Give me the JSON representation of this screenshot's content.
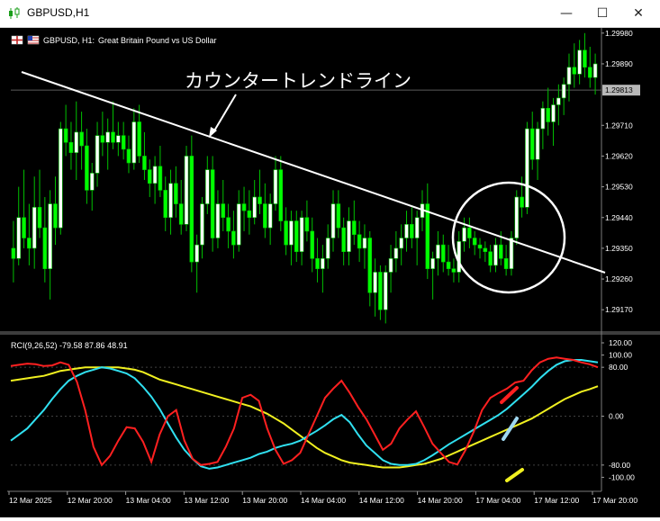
{
  "window": {
    "title": "GBPUSD,H1",
    "icons": {
      "app": "candle-chart-icon",
      "minimize": "minimize-icon",
      "maximize": "maximize-icon",
      "close": "close-icon"
    },
    "controls": {
      "minimize": "—",
      "maximize": "☐",
      "close": "✕"
    }
  },
  "chart": {
    "header_symbol": "GBPUSD, H1:",
    "header_desc": "Great Britain Pound vs US Dollar",
    "price_axis_labels": [
      "1.29980",
      "1.29890",
      "1.29710",
      "1.29620",
      "1.29530",
      "1.29440",
      "1.29350",
      "1.29260",
      "1.29170"
    ],
    "current_price_label": "1.29813",
    "annotation": "カウンタートレンドライン",
    "colors": {
      "background": "#000000",
      "bull": "#ffffff",
      "bear": "#00ff00",
      "wick": "#00c000",
      "trendline": "#ffffff",
      "circle": "#ffffff"
    }
  },
  "indicator": {
    "label": "RCI(9,26,52) -79.58 87.86 48.91",
    "axis_labels": [
      "120.00",
      "100.00",
      "80.00",
      "0.00",
      "-80.00",
      "-100.00"
    ],
    "colors": {
      "fast": "#ff2020",
      "mid": "#30e0f0",
      "slow": "#f0f020"
    }
  },
  "time_axis_labels": [
    "12 Mar 2025",
    "12 Mar 20:00",
    "13 Mar 04:00",
    "13 Mar 12:00",
    "13 Mar 20:00",
    "14 Mar 04:00",
    "14 Mar 12:00",
    "14 Mar 20:00",
    "17 Mar 04:00",
    "17 Mar 12:00",
    "17 Mar 20:00"
  ],
  "chart_data": {
    "type": "candlestick",
    "price_ylim": [
      1.2911,
      1.2999
    ],
    "candles": [
      [
        1.2935,
        1.2943,
        1.2925,
        1.2932
      ],
      [
        1.2932,
        1.2953,
        1.293,
        1.2944
      ],
      [
        1.2944,
        1.2958,
        1.2935,
        1.2938
      ],
      [
        1.2938,
        1.2948,
        1.293,
        1.2935
      ],
      [
        1.2935,
        1.2956,
        1.2929,
        1.2947
      ],
      [
        1.2947,
        1.2958,
        1.2938,
        1.2941
      ],
      [
        1.2941,
        1.295,
        1.2925,
        1.2929
      ],
      [
        1.2929,
        1.2952,
        1.292,
        1.2948
      ],
      [
        1.2948,
        1.2956,
        1.2936,
        1.2941
      ],
      [
        1.2941,
        1.2972,
        1.2939,
        1.297
      ],
      [
        1.297,
        1.2977,
        1.2962,
        1.2966
      ],
      [
        1.2966,
        1.2972,
        1.2958,
        1.2963
      ],
      [
        1.2963,
        1.2978,
        1.2955,
        1.2969
      ],
      [
        1.2969,
        1.2975,
        1.2958,
        1.2965
      ],
      [
        1.2965,
        1.297,
        1.2948,
        1.2952
      ],
      [
        1.2952,
        1.296,
        1.2946,
        1.2957
      ],
      [
        1.2957,
        1.2972,
        1.2953,
        1.2968
      ],
      [
        1.2968,
        1.2975,
        1.2962,
        1.2966
      ],
      [
        1.2966,
        1.2973,
        1.2958,
        1.2969
      ],
      [
        1.2969,
        1.2978,
        1.2964,
        1.2966
      ],
      [
        1.2966,
        1.2972,
        1.2962,
        1.2968
      ],
      [
        1.2968,
        1.2972,
        1.2961,
        1.2964
      ],
      [
        1.2964,
        1.2968,
        1.2957,
        1.296
      ],
      [
        1.296,
        1.2976,
        1.2958,
        1.2972
      ],
      [
        1.2972,
        1.2977,
        1.296,
        1.2962
      ],
      [
        1.2962,
        1.2969,
        1.2955,
        1.2958
      ],
      [
        1.2958,
        1.2961,
        1.295,
        1.2954
      ],
      [
        1.2954,
        1.2962,
        1.2948,
        1.2959
      ],
      [
        1.2959,
        1.2965,
        1.295,
        1.2952
      ],
      [
        1.2952,
        1.2956,
        1.294,
        1.2944
      ],
      [
        1.2944,
        1.2958,
        1.2939,
        1.2954
      ],
      [
        1.2954,
        1.2959,
        1.2944,
        1.2948
      ],
      [
        1.2948,
        1.2955,
        1.2939,
        1.2942
      ],
      [
        1.2942,
        1.2965,
        1.294,
        1.2962
      ],
      [
        1.2962,
        1.2968,
        1.2928,
        1.2931
      ],
      [
        1.2931,
        1.2939,
        1.2922,
        1.2936
      ],
      [
        1.2936,
        1.295,
        1.2932,
        1.2948
      ],
      [
        1.2948,
        1.2962,
        1.2945,
        1.2958
      ],
      [
        1.2958,
        1.2962,
        1.2934,
        1.2938
      ],
      [
        1.2938,
        1.2952,
        1.2935,
        1.2948
      ],
      [
        1.2948,
        1.2955,
        1.294,
        1.2944
      ],
      [
        1.2944,
        1.2948,
        1.2935,
        1.294
      ],
      [
        1.294,
        1.2946,
        1.2932,
        1.2936
      ],
      [
        1.2936,
        1.2952,
        1.2934,
        1.2948
      ],
      [
        1.2948,
        1.2953,
        1.294,
        1.2946
      ],
      [
        1.2946,
        1.2952,
        1.2939,
        1.2944
      ],
      [
        1.2944,
        1.2955,
        1.2942,
        1.295
      ],
      [
        1.295,
        1.2958,
        1.2945,
        1.2948
      ],
      [
        1.2948,
        1.2954,
        1.2938,
        1.2941
      ],
      [
        1.2941,
        1.2951,
        1.2936,
        1.2948
      ],
      [
        1.2948,
        1.2962,
        1.2946,
        1.2958
      ],
      [
        1.2958,
        1.2962,
        1.294,
        1.2943
      ],
      [
        1.2943,
        1.2947,
        1.2933,
        1.2936
      ],
      [
        1.2936,
        1.2946,
        1.293,
        1.2943
      ],
      [
        1.2943,
        1.2946,
        1.2931,
        1.2934
      ],
      [
        1.2934,
        1.2946,
        1.293,
        1.2944
      ],
      [
        1.2944,
        1.2949,
        1.2937,
        1.294
      ],
      [
        1.294,
        1.2944,
        1.2928,
        1.2932
      ],
      [
        1.2932,
        1.2938,
        1.2925,
        1.2929
      ],
      [
        1.2929,
        1.2936,
        1.2922,
        1.2932
      ],
      [
        1.2932,
        1.2942,
        1.2929,
        1.2938
      ],
      [
        1.2938,
        1.2952,
        1.2934,
        1.2948
      ],
      [
        1.2948,
        1.2952,
        1.2938,
        1.2941
      ],
      [
        1.2941,
        1.2944,
        1.293,
        1.2934
      ],
      [
        1.2934,
        1.2947,
        1.293,
        1.2943
      ],
      [
        1.2943,
        1.2949,
        1.2936,
        1.2939
      ],
      [
        1.2939,
        1.2943,
        1.2931,
        1.2935
      ],
      [
        1.2935,
        1.2942,
        1.2929,
        1.2938
      ],
      [
        1.2938,
        1.294,
        1.2918,
        1.2922
      ],
      [
        1.2922,
        1.2932,
        1.2915,
        1.2928
      ],
      [
        1.2928,
        1.293,
        1.2914,
        1.2917
      ],
      [
        1.2917,
        1.293,
        1.2913,
        1.2928
      ],
      [
        1.2928,
        1.2936,
        1.2922,
        1.2932
      ],
      [
        1.2932,
        1.294,
        1.2928,
        1.2935
      ],
      [
        1.2935,
        1.2942,
        1.293,
        1.2938
      ],
      [
        1.2938,
        1.2946,
        1.2934,
        1.2942
      ],
      [
        1.2942,
        1.2947,
        1.2935,
        1.2938
      ],
      [
        1.2938,
        1.2946,
        1.293,
        1.2944
      ],
      [
        1.2944,
        1.2952,
        1.294,
        1.2948
      ],
      [
        1.2948,
        1.2954,
        1.2926,
        1.2929
      ],
      [
        1.2929,
        1.2934,
        1.292,
        1.2932
      ],
      [
        1.2932,
        1.294,
        1.2927,
        1.2936
      ],
      [
        1.2936,
        1.2939,
        1.2928,
        1.2931
      ],
      [
        1.2931,
        1.2936,
        1.2927,
        1.2929
      ],
      [
        1.2929,
        1.2932,
        1.2925,
        1.2928
      ],
      [
        1.2928,
        1.294,
        1.2925,
        1.2937
      ],
      [
        1.2937,
        1.2944,
        1.2934,
        1.2941
      ],
      [
        1.2941,
        1.2944,
        1.2935,
        1.2938
      ],
      [
        1.2938,
        1.294,
        1.2933,
        1.2936
      ],
      [
        1.2936,
        1.2938,
        1.2932,
        1.2935
      ],
      [
        1.2935,
        1.2937,
        1.2931,
        1.2934
      ],
      [
        1.2934,
        1.2936,
        1.2928,
        1.293
      ],
      [
        1.293,
        1.2938,
        1.2928,
        1.2936
      ],
      [
        1.2936,
        1.294,
        1.293,
        1.2932
      ],
      [
        1.2932,
        1.2936,
        1.2927,
        1.2929
      ],
      [
        1.2929,
        1.294,
        1.2927,
        1.2938
      ],
      [
        1.2938,
        1.2952,
        1.2936,
        1.295
      ],
      [
        1.295,
        1.2956,
        1.2944,
        1.2947
      ],
      [
        1.2947,
        1.2972,
        1.2945,
        1.297
      ],
      [
        1.297,
        1.2975,
        1.2958,
        1.2961
      ],
      [
        1.2961,
        1.2972,
        1.2955,
        1.297
      ],
      [
        1.297,
        1.2978,
        1.2964,
        1.2976
      ],
      [
        1.2976,
        1.2982,
        1.2968,
        1.2972
      ],
      [
        1.2972,
        1.2979,
        1.2965,
        1.2977
      ],
      [
        1.2977,
        1.2983,
        1.2971,
        1.2979
      ],
      [
        1.2979,
        1.2985,
        1.2974,
        1.2983
      ],
      [
        1.2983,
        1.2992,
        1.2978,
        1.2988
      ],
      [
        1.2988,
        1.2995,
        1.2982,
        1.2986
      ],
      [
        1.2986,
        1.2996,
        1.2983,
        1.2993
      ],
      [
        1.2993,
        1.2998,
        1.2985,
        1.2988
      ],
      [
        1.2988,
        1.2994,
        1.2982,
        1.2985
      ],
      [
        1.2985,
        1.2992,
        1.298,
        1.2989
      ]
    ],
    "indicator_ylim": [
      -120,
      120
    ],
    "rci_fast": [
      82,
      84,
      86,
      85,
      82,
      83,
      88,
      84,
      56,
      10,
      -50,
      -80,
      -65,
      -40,
      -18,
      -20,
      -42,
      -75,
      -30,
      0,
      10,
      -40,
      -70,
      -80,
      -78,
      -75,
      -50,
      -20,
      30,
      35,
      25,
      -20,
      -55,
      -78,
      -72,
      -60,
      -30,
      0,
      30,
      45,
      58,
      38,
      15,
      -5,
      -30,
      -55,
      -45,
      -20,
      -5,
      8,
      -18,
      -45,
      -60,
      -75,
      -79,
      -55,
      -25,
      10,
      30,
      38,
      45,
      55,
      58,
      75,
      88,
      94,
      96,
      94,
      92,
      88,
      85,
      80
    ],
    "rci_mid": [
      -40,
      -30,
      -20,
      -5,
      10,
      28,
      44,
      58,
      66,
      72,
      76,
      80,
      78,
      74,
      70,
      62,
      48,
      32,
      12,
      -12,
      -35,
      -55,
      -70,
      -82,
      -86,
      -84,
      -80,
      -76,
      -72,
      -68,
      -62,
      -58,
      -52,
      -48,
      -45,
      -40,
      -32,
      -24,
      -15,
      -5,
      2,
      -10,
      -30,
      -48,
      -60,
      -72,
      -78,
      -80,
      -80,
      -78,
      -72,
      -64,
      -55,
      -46,
      -38,
      -30,
      -22,
      -14,
      -6,
      2,
      12,
      24,
      36,
      48,
      62,
      74,
      84,
      90,
      92,
      92,
      90,
      88
    ],
    "rci_slow": [
      58,
      60,
      62,
      64,
      66,
      70,
      74,
      76,
      78,
      80,
      80,
      80,
      80,
      80,
      78,
      76,
      72,
      66,
      60,
      56,
      52,
      48,
      44,
      40,
      36,
      32,
      28,
      24,
      20,
      16,
      10,
      4,
      -4,
      -12,
      -22,
      -32,
      -42,
      -52,
      -60,
      -66,
      -72,
      -76,
      -78,
      -80,
      -82,
      -84,
      -84,
      -84,
      -82,
      -80,
      -78,
      -74,
      -70,
      -64,
      -58,
      -52,
      -46,
      -40,
      -34,
      -28,
      -22,
      -16,
      -10,
      -4,
      4,
      12,
      20,
      28,
      34,
      40,
      44,
      49
    ]
  }
}
